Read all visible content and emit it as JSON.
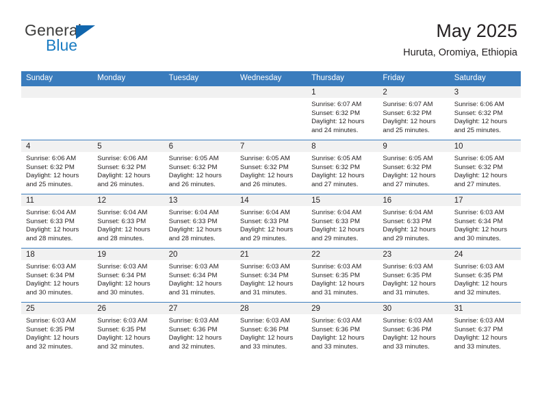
{
  "brand": {
    "name_top": "General",
    "name_bottom": "Blue",
    "triangle_color": "#1166ad",
    "accent_color": "#3a7cbd"
  },
  "header": {
    "title": "May 2025",
    "subtitle": "Huruta, Oromiya, Ethiopia"
  },
  "calendar": {
    "weekday_headers": [
      "Sunday",
      "Monday",
      "Tuesday",
      "Wednesday",
      "Thursday",
      "Friday",
      "Saturday"
    ],
    "weeks": [
      [
        {
          "day": "",
          "empty": true
        },
        {
          "day": "",
          "empty": true
        },
        {
          "day": "",
          "empty": true
        },
        {
          "day": "",
          "empty": true
        },
        {
          "day": "1",
          "sunrise": "Sunrise: 6:07 AM",
          "sunset": "Sunset: 6:32 PM",
          "daylight1": "Daylight: 12 hours",
          "daylight2": "and 24 minutes."
        },
        {
          "day": "2",
          "sunrise": "Sunrise: 6:07 AM",
          "sunset": "Sunset: 6:32 PM",
          "daylight1": "Daylight: 12 hours",
          "daylight2": "and 25 minutes."
        },
        {
          "day": "3",
          "sunrise": "Sunrise: 6:06 AM",
          "sunset": "Sunset: 6:32 PM",
          "daylight1": "Daylight: 12 hours",
          "daylight2": "and 25 minutes."
        }
      ],
      [
        {
          "day": "4",
          "sunrise": "Sunrise: 6:06 AM",
          "sunset": "Sunset: 6:32 PM",
          "daylight1": "Daylight: 12 hours",
          "daylight2": "and 25 minutes."
        },
        {
          "day": "5",
          "sunrise": "Sunrise: 6:06 AM",
          "sunset": "Sunset: 6:32 PM",
          "daylight1": "Daylight: 12 hours",
          "daylight2": "and 26 minutes."
        },
        {
          "day": "6",
          "sunrise": "Sunrise: 6:05 AM",
          "sunset": "Sunset: 6:32 PM",
          "daylight1": "Daylight: 12 hours",
          "daylight2": "and 26 minutes."
        },
        {
          "day": "7",
          "sunrise": "Sunrise: 6:05 AM",
          "sunset": "Sunset: 6:32 PM",
          "daylight1": "Daylight: 12 hours",
          "daylight2": "and 26 minutes."
        },
        {
          "day": "8",
          "sunrise": "Sunrise: 6:05 AM",
          "sunset": "Sunset: 6:32 PM",
          "daylight1": "Daylight: 12 hours",
          "daylight2": "and 27 minutes."
        },
        {
          "day": "9",
          "sunrise": "Sunrise: 6:05 AM",
          "sunset": "Sunset: 6:32 PM",
          "daylight1": "Daylight: 12 hours",
          "daylight2": "and 27 minutes."
        },
        {
          "day": "10",
          "sunrise": "Sunrise: 6:05 AM",
          "sunset": "Sunset: 6:32 PM",
          "daylight1": "Daylight: 12 hours",
          "daylight2": "and 27 minutes."
        }
      ],
      [
        {
          "day": "11",
          "sunrise": "Sunrise: 6:04 AM",
          "sunset": "Sunset: 6:33 PM",
          "daylight1": "Daylight: 12 hours",
          "daylight2": "and 28 minutes."
        },
        {
          "day": "12",
          "sunrise": "Sunrise: 6:04 AM",
          "sunset": "Sunset: 6:33 PM",
          "daylight1": "Daylight: 12 hours",
          "daylight2": "and 28 minutes."
        },
        {
          "day": "13",
          "sunrise": "Sunrise: 6:04 AM",
          "sunset": "Sunset: 6:33 PM",
          "daylight1": "Daylight: 12 hours",
          "daylight2": "and 28 minutes."
        },
        {
          "day": "14",
          "sunrise": "Sunrise: 6:04 AM",
          "sunset": "Sunset: 6:33 PM",
          "daylight1": "Daylight: 12 hours",
          "daylight2": "and 29 minutes."
        },
        {
          "day": "15",
          "sunrise": "Sunrise: 6:04 AM",
          "sunset": "Sunset: 6:33 PM",
          "daylight1": "Daylight: 12 hours",
          "daylight2": "and 29 minutes."
        },
        {
          "day": "16",
          "sunrise": "Sunrise: 6:04 AM",
          "sunset": "Sunset: 6:33 PM",
          "daylight1": "Daylight: 12 hours",
          "daylight2": "and 29 minutes."
        },
        {
          "day": "17",
          "sunrise": "Sunrise: 6:03 AM",
          "sunset": "Sunset: 6:34 PM",
          "daylight1": "Daylight: 12 hours",
          "daylight2": "and 30 minutes."
        }
      ],
      [
        {
          "day": "18",
          "sunrise": "Sunrise: 6:03 AM",
          "sunset": "Sunset: 6:34 PM",
          "daylight1": "Daylight: 12 hours",
          "daylight2": "and 30 minutes."
        },
        {
          "day": "19",
          "sunrise": "Sunrise: 6:03 AM",
          "sunset": "Sunset: 6:34 PM",
          "daylight1": "Daylight: 12 hours",
          "daylight2": "and 30 minutes."
        },
        {
          "day": "20",
          "sunrise": "Sunrise: 6:03 AM",
          "sunset": "Sunset: 6:34 PM",
          "daylight1": "Daylight: 12 hours",
          "daylight2": "and 31 minutes."
        },
        {
          "day": "21",
          "sunrise": "Sunrise: 6:03 AM",
          "sunset": "Sunset: 6:34 PM",
          "daylight1": "Daylight: 12 hours",
          "daylight2": "and 31 minutes."
        },
        {
          "day": "22",
          "sunrise": "Sunrise: 6:03 AM",
          "sunset": "Sunset: 6:35 PM",
          "daylight1": "Daylight: 12 hours",
          "daylight2": "and 31 minutes."
        },
        {
          "day": "23",
          "sunrise": "Sunrise: 6:03 AM",
          "sunset": "Sunset: 6:35 PM",
          "daylight1": "Daylight: 12 hours",
          "daylight2": "and 31 minutes."
        },
        {
          "day": "24",
          "sunrise": "Sunrise: 6:03 AM",
          "sunset": "Sunset: 6:35 PM",
          "daylight1": "Daylight: 12 hours",
          "daylight2": "and 32 minutes."
        }
      ],
      [
        {
          "day": "25",
          "sunrise": "Sunrise: 6:03 AM",
          "sunset": "Sunset: 6:35 PM",
          "daylight1": "Daylight: 12 hours",
          "daylight2": "and 32 minutes."
        },
        {
          "day": "26",
          "sunrise": "Sunrise: 6:03 AM",
          "sunset": "Sunset: 6:35 PM",
          "daylight1": "Daylight: 12 hours",
          "daylight2": "and 32 minutes."
        },
        {
          "day": "27",
          "sunrise": "Sunrise: 6:03 AM",
          "sunset": "Sunset: 6:36 PM",
          "daylight1": "Daylight: 12 hours",
          "daylight2": "and 32 minutes."
        },
        {
          "day": "28",
          "sunrise": "Sunrise: 6:03 AM",
          "sunset": "Sunset: 6:36 PM",
          "daylight1": "Daylight: 12 hours",
          "daylight2": "and 33 minutes."
        },
        {
          "day": "29",
          "sunrise": "Sunrise: 6:03 AM",
          "sunset": "Sunset: 6:36 PM",
          "daylight1": "Daylight: 12 hours",
          "daylight2": "and 33 minutes."
        },
        {
          "day": "30",
          "sunrise": "Sunrise: 6:03 AM",
          "sunset": "Sunset: 6:36 PM",
          "daylight1": "Daylight: 12 hours",
          "daylight2": "and 33 minutes."
        },
        {
          "day": "31",
          "sunrise": "Sunrise: 6:03 AM",
          "sunset": "Sunset: 6:37 PM",
          "daylight1": "Daylight: 12 hours",
          "daylight2": "and 33 minutes."
        }
      ]
    ]
  }
}
